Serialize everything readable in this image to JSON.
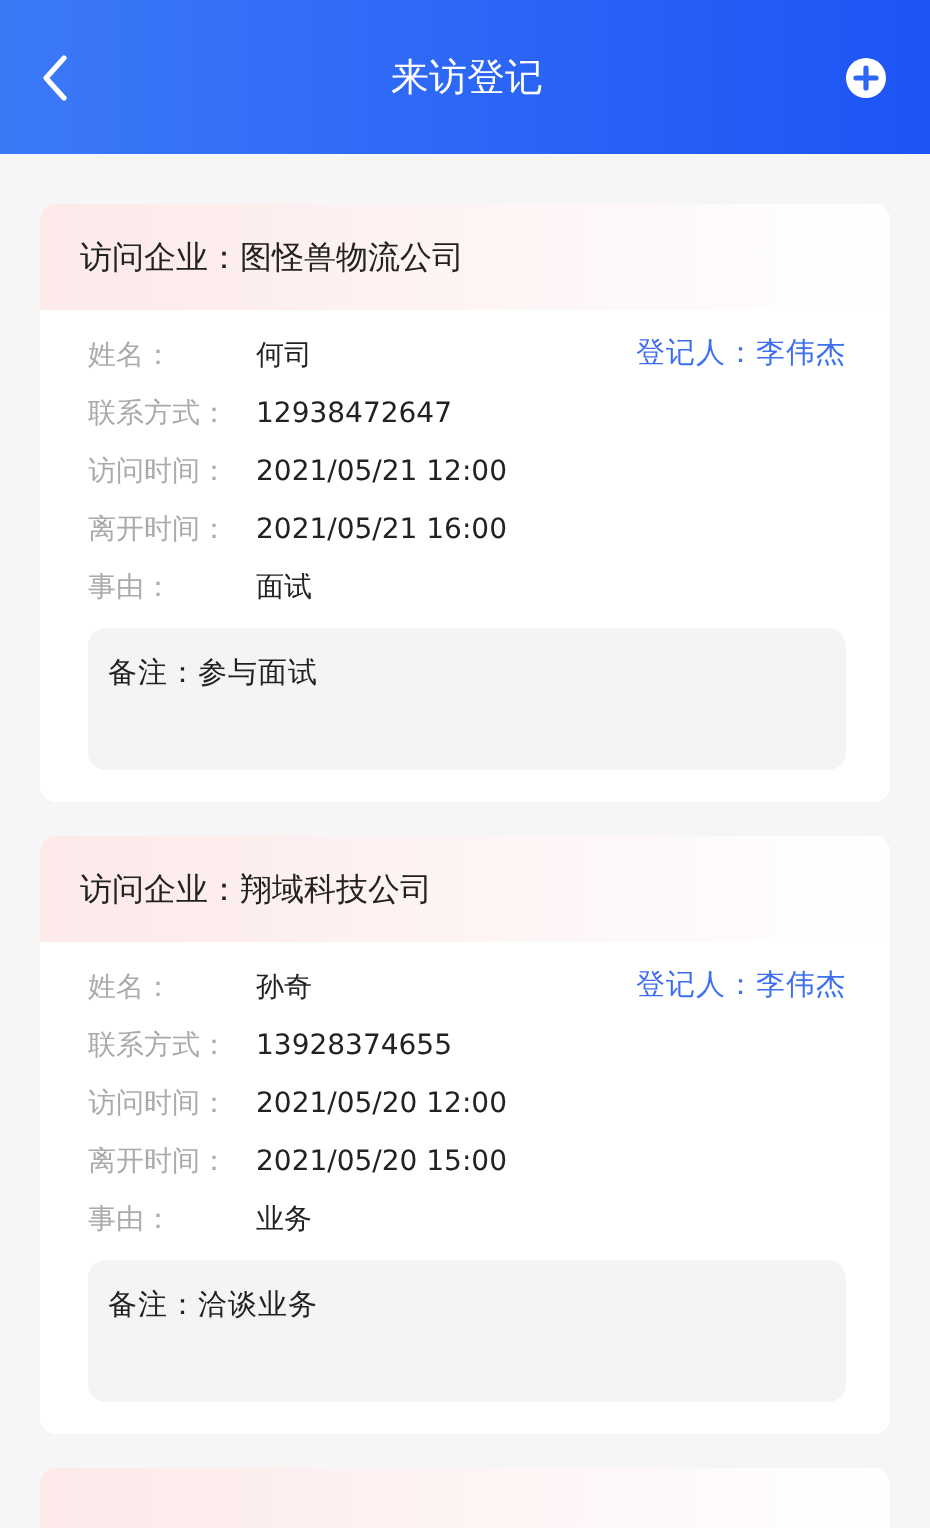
{
  "header": {
    "title": "来访登记"
  },
  "visits": [
    {
      "company_label": "访问企业：",
      "company": "图怪兽物流公司",
      "registrar": "登记人：李伟杰",
      "fields": [
        {
          "label": "姓名：",
          "value": "何司"
        },
        {
          "label": "联系方式：",
          "value": "12938472647"
        },
        {
          "label": "访问时间：",
          "value": "2021/05/21 12:00"
        },
        {
          "label": "离开时间：",
          "value": "2021/05/21 16:00"
        },
        {
          "label": "事由：",
          "value": "面试"
        }
      ],
      "note": "备注：参与面试"
    },
    {
      "company_label": "访问企业：",
      "company": "翔域科技公司",
      "registrar": "登记人：李伟杰",
      "fields": [
        {
          "label": "姓名：",
          "value": "孙奇"
        },
        {
          "label": "联系方式：",
          "value": "13928374655"
        },
        {
          "label": "访问时间：",
          "value": "2021/05/20 12:00"
        },
        {
          "label": "离开时间：",
          "value": "2021/05/20 15:00"
        },
        {
          "label": "事由：",
          "value": "业务"
        }
      ],
      "note": "备注：洽谈业务"
    }
  ]
}
